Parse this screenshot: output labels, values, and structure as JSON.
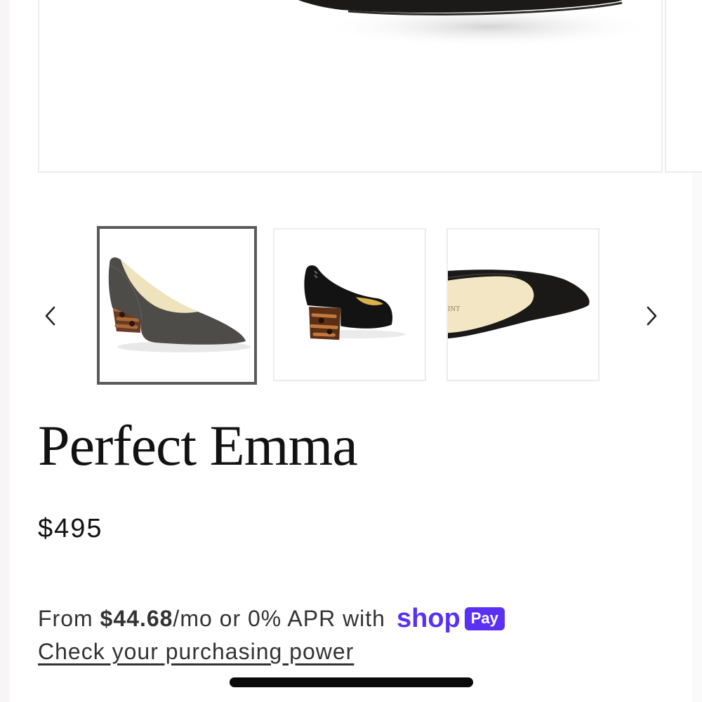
{
  "gallery": {
    "prev_label": "Previous",
    "next_label": "Next",
    "thumbnails": [
      {
        "alt": "Perfect Emma side view",
        "selected": true
      },
      {
        "alt": "Perfect Emma back view",
        "selected": false
      },
      {
        "alt": "Perfect Emma insole view",
        "selected": false
      }
    ],
    "insole_brand_text": "INT"
  },
  "product": {
    "title": "Perfect Emma",
    "price": "$495"
  },
  "financing": {
    "prefix": "From ",
    "monthly_amount": "$44.68",
    "suffix": "/mo or 0% APR with",
    "shop_word": "shop",
    "pay_badge": "Pay",
    "link_label": "Check your purchasing power"
  },
  "colors": {
    "shop_pay_purple": "#5a31f4",
    "selected_border": "#5a5a5a",
    "text": "#121212"
  },
  "icons": {
    "prev": "chevron-left-icon",
    "next": "chevron-right-icon"
  }
}
